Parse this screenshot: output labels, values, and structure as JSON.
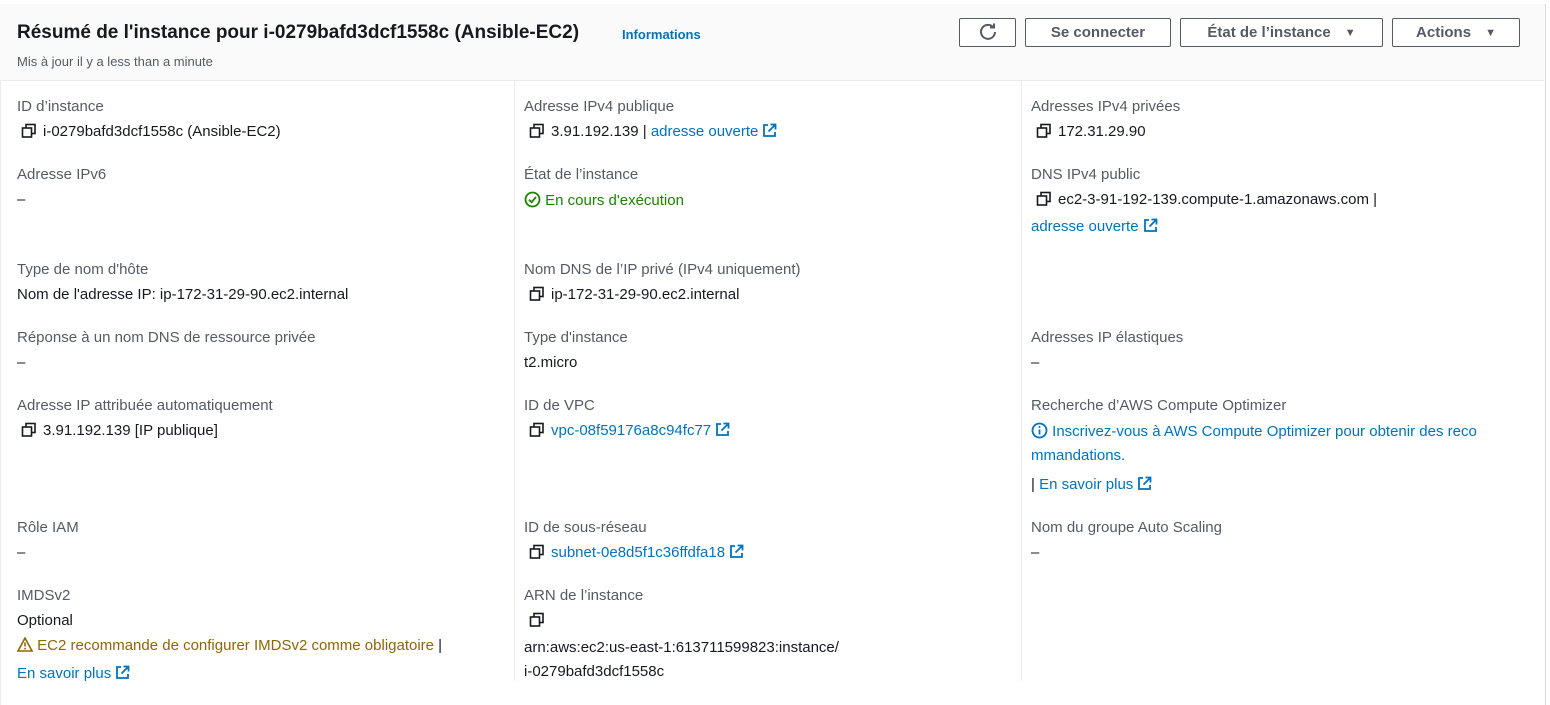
{
  "header": {
    "title": "Résumé de l'instance pour i-0279bafd3dcf1558c (Ansible-EC2)",
    "info_link": "Informations",
    "subtitle": "Mis à jour il y a less than a minute",
    "buttons": {
      "refresh_icon": "refresh-icon",
      "connect": "Se connecter",
      "instance_state": "État de l’instance",
      "actions": "Actions"
    }
  },
  "col1": {
    "instance_id_label": "ID d’instance",
    "instance_id_value": "i-0279bafd3dcf1558c (Ansible-EC2)",
    "ipv6_label": "Adresse IPv6",
    "ipv6_value": "–",
    "hostname_type_label": "Type de nom d'hôte",
    "hostname_type_value": "Nom de l'adresse IP: ip-172-31-29-90.ec2.internal",
    "dns_response_label": "Réponse à un nom DNS de ressource privée",
    "dns_response_value": "–",
    "auto_ip_label": "Adresse IP attribuée automatiquement",
    "auto_ip_value": "3.91.192.139 [IP publique]",
    "iam_role_label": "Rôle IAM",
    "iam_role_value": "–",
    "imdsv2_label": "IMDSv2",
    "imdsv2_value": "Optional",
    "imdsv2_warning": "EC2 recommande de configurer IMDSv2 comme obligatoire",
    "imdsv2_learn_more": "En savoir plus"
  },
  "col2": {
    "public_ipv4_label": "Adresse IPv4 publique",
    "public_ipv4_value": "3.91.192.139",
    "public_ipv4_open": "adresse ouverte",
    "state_label": "État de l’instance",
    "state_value": "En cours d'exécution",
    "private_dns_label": "Nom DNS de l’IP privé (IPv4 uniquement)",
    "private_dns_value": "ip-172-31-29-90.ec2.internal",
    "instance_type_label": "Type d'instance",
    "instance_type_value": "t2.micro",
    "vpc_label": "ID de VPC",
    "vpc_value": "vpc-08f59176a8c94fc77",
    "subnet_label": "ID de sous-réseau",
    "subnet_value": "subnet-0e8d5f1c36ffdfa18",
    "arn_label": "ARN de l’instance",
    "arn_line1": "arn:aws:ec2:us-east-1:613711599823:instance/",
    "arn_line2": "i-0279bafd3dcf1558c"
  },
  "col3": {
    "private_ipv4_label": "Adresses IPv4 privées",
    "private_ipv4_value": "172.31.29.90",
    "public_dns_label": "DNS IPv4 public",
    "public_dns_value": "ec2-3-91-192-139.compute-1.amazonaws.com",
    "public_dns_open": "adresse ouverte",
    "elastic_ip_label": "Adresses IP élastiques",
    "elastic_ip_value": "–",
    "optimizer_label": "Recherche d’AWS Compute Optimizer",
    "optimizer_line1": "Inscrivez-vous à AWS Compute Optimizer pour obtenir des reco",
    "optimizer_line2": "mmandations.",
    "optimizer_learn_more": "En savoir plus",
    "asg_label": "Nom du groupe Auto Scaling",
    "asg_value": "–"
  },
  "colors": {
    "link": "#0073bb",
    "success": "#1d8102",
    "warning": "#8d6605",
    "text": "#16191f",
    "label": "#545b64"
  }
}
